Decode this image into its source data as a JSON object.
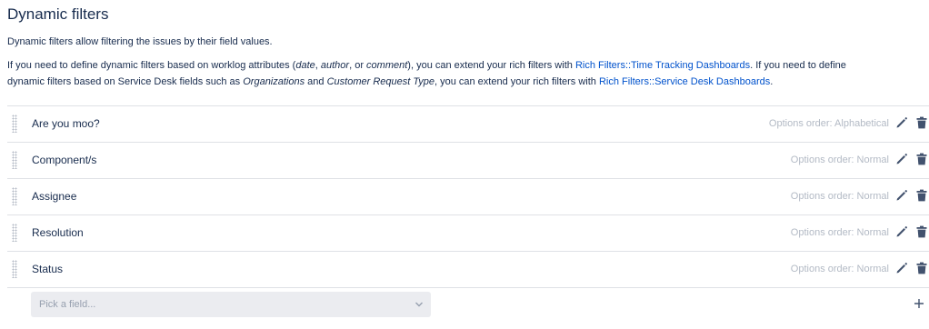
{
  "title": "Dynamic filters",
  "description": "Dynamic filters allow filtering the issues by their field values.",
  "info": {
    "t1": "If you need to define dynamic filters based on worklog attributes (",
    "e1": "date",
    "t2": ", ",
    "e2": "author",
    "t3": ", or ",
    "e3": "comment",
    "t4": "), you can extend your rich filters with ",
    "link1": "Rich Filters::Time Tracking Dashboards",
    "t5": ". If you need to define",
    "t6": "dynamic filters based on Service Desk fields such as ",
    "e4": "Organizations",
    "t7": " and ",
    "e5": "Customer Request Type",
    "t8": ", you can extend your rich filters with ",
    "link2": "Rich Filters::Service Desk Dashboards",
    "t9": "."
  },
  "filters": [
    {
      "name": "Are you moo?",
      "order": "Options order: Alphabetical"
    },
    {
      "name": "Component/s",
      "order": "Options order: Normal"
    },
    {
      "name": "Assignee",
      "order": "Options order: Normal"
    },
    {
      "name": "Resolution",
      "order": "Options order: Normal"
    },
    {
      "name": "Status",
      "order": "Options order: Normal"
    }
  ],
  "picker": {
    "placeholder": "Pick a field..."
  },
  "icons": {
    "drag": "drag-handle-icon",
    "edit": "pencil-icon",
    "delete": "trash-icon",
    "chevron": "chevron-down-icon",
    "add": "plus-icon"
  },
  "colors": {
    "link": "#0052cc",
    "text": "#172b4d",
    "muted": "#b3bac5",
    "divider": "#dfe1e6",
    "picker_bg": "#ebecf0"
  }
}
